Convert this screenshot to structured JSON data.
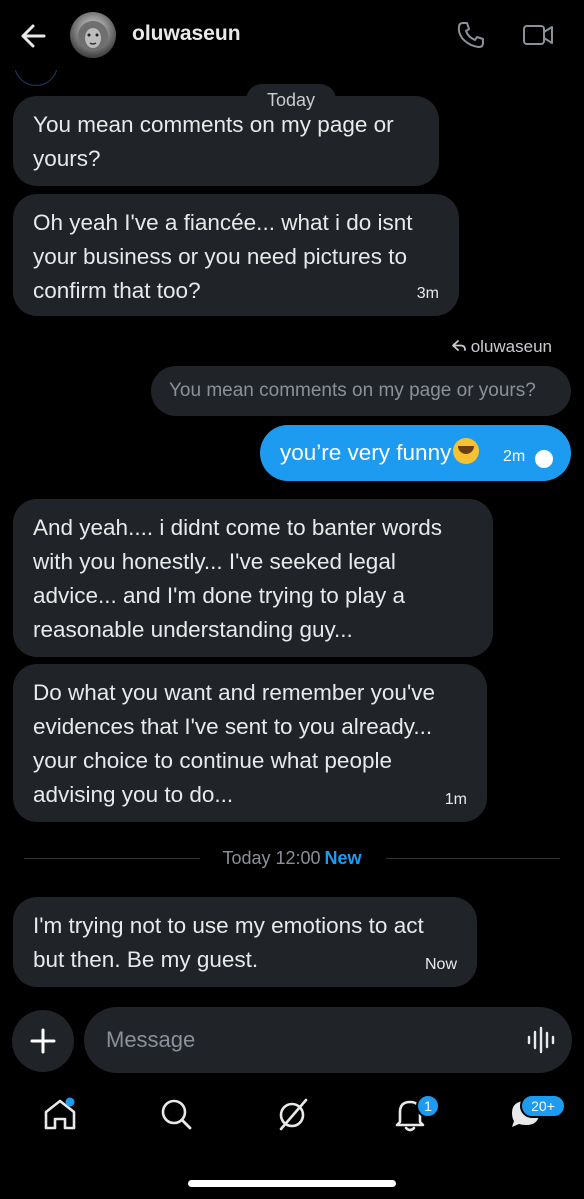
{
  "header": {
    "name": "oluwaseun"
  },
  "date_pill": "Today",
  "messages": {
    "m1": "You mean comments on my page or yours?",
    "m2": "Oh yeah I've a fiancée... what i do isnt your business or you need pictures to confirm that too?",
    "m2_time": "3m",
    "reply_to": "oluwaseun",
    "reply_quote": "You mean comments on my page or yours?",
    "sent": "you’re very funny",
    "sent_time": "2m",
    "m3": "And yeah.... i didnt come to banter words with you honestly... I've seeked legal advice... and I'm done trying to play a reasonable understanding guy...",
    "m4": "Do what you want and remember you've evidences that I've sent to you already... your choice to continue what people advising you to do...",
    "m4_time": "1m",
    "m5": "I'm trying not to use my emotions to act but then. Be my guest.",
    "m5_time": "Now"
  },
  "divider": {
    "text": "Today 12:00",
    "new_label": "New"
  },
  "composer": {
    "placeholder": "Message"
  },
  "tabbar": {
    "notifications_badge": "1",
    "messages_badge": "20+"
  },
  "colors": {
    "accent": "#1d9bf0",
    "bubble": "#202327",
    "background": "#000000"
  }
}
